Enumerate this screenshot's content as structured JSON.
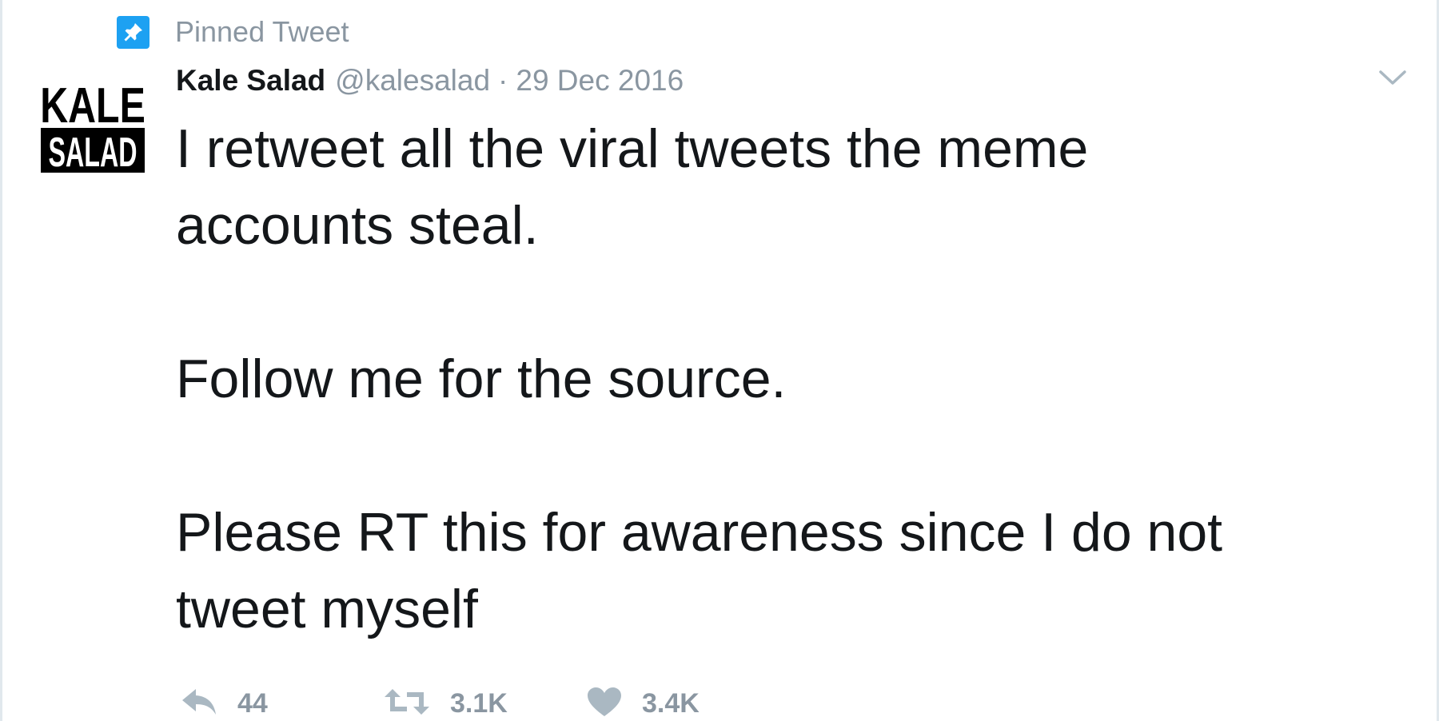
{
  "pinned": {
    "label": "Pinned Tweet",
    "icon": "pin-icon",
    "badge_color": "#1da1f2"
  },
  "author": {
    "avatar_lines": [
      "KALE",
      "SALAD"
    ],
    "display_name": "Kale Salad",
    "handle": "@kalesalad",
    "separator": "·",
    "timestamp": "29 Dec 2016"
  },
  "tweet": {
    "paragraphs": [
      [
        "I retweet all the viral tweets the meme",
        "accounts steal."
      ],
      [
        "Follow me for the source."
      ],
      [
        "Please RT this for awareness since I do not",
        "tweet myself"
      ]
    ]
  },
  "actions": {
    "reply": {
      "icon": "reply-icon",
      "count": "44"
    },
    "retweet": {
      "icon": "retweet-icon",
      "count": "3.1K"
    },
    "like": {
      "icon": "heart-icon",
      "count": "3.4K"
    }
  },
  "menu": {
    "icon": "chevron-down-icon"
  },
  "colors": {
    "accent": "#1da1f2",
    "muted": "#8a96a1",
    "text": "#14171a",
    "border": "#e1e8ed"
  }
}
